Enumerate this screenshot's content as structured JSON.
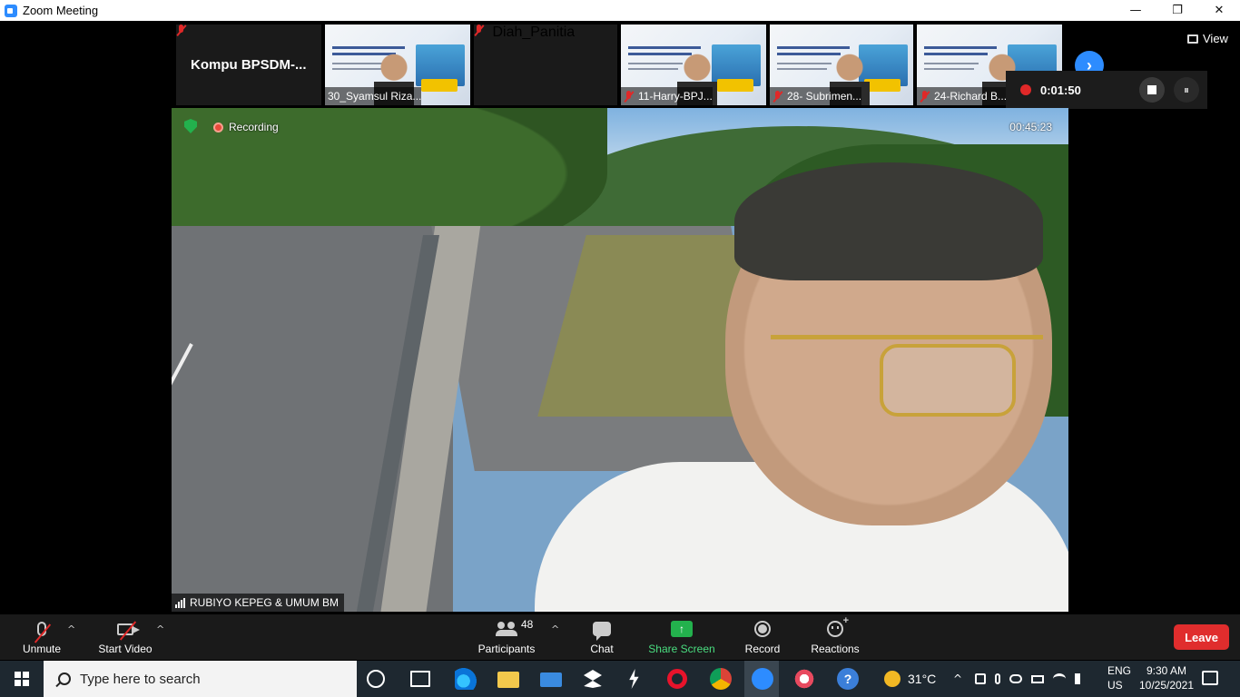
{
  "window": {
    "title": "Zoom Meeting",
    "minimize": "—",
    "maximize": "❐",
    "close": "✕"
  },
  "gallery": {
    "self_name": "Kompu  BPSDM-...",
    "thumbnails": [
      {
        "name": "30_Syamsul Riza..."
      },
      {
        "name": "Diah_Panitia"
      },
      {
        "name": "11-Harry-BPJ..."
      },
      {
        "name": "28- Subrimen..."
      },
      {
        "name": "24-Richard B..."
      }
    ],
    "next_arrow": "›"
  },
  "view": {
    "label": "View"
  },
  "recording_panel": {
    "elapsed": "0:01:50",
    "pause_icon": "⏸"
  },
  "main_video": {
    "recording_label": "Recording",
    "timer": "00:45:23",
    "speaker_name": "RUBIYO KEPEG & UMUM BM"
  },
  "controls": {
    "unmute": "Unmute",
    "start_video": "Start Video",
    "participants": "Participants",
    "participants_count": "48",
    "chat": "Chat",
    "share_screen": "Share Screen",
    "record": "Record",
    "reactions": "Reactions",
    "leave": "Leave",
    "caret": "^"
  },
  "taskbar": {
    "search_placeholder": "Type here to search",
    "weather": "31°C",
    "language_top": "ENG",
    "language_bottom": "US",
    "time": "9:30 AM",
    "date": "10/25/2021",
    "chevron": "^"
  },
  "colors": {
    "zoom_blue": "#2d8cff",
    "muted_red": "#e02828",
    "share_green": "#23b14d",
    "leave_red": "#e02d2d"
  }
}
